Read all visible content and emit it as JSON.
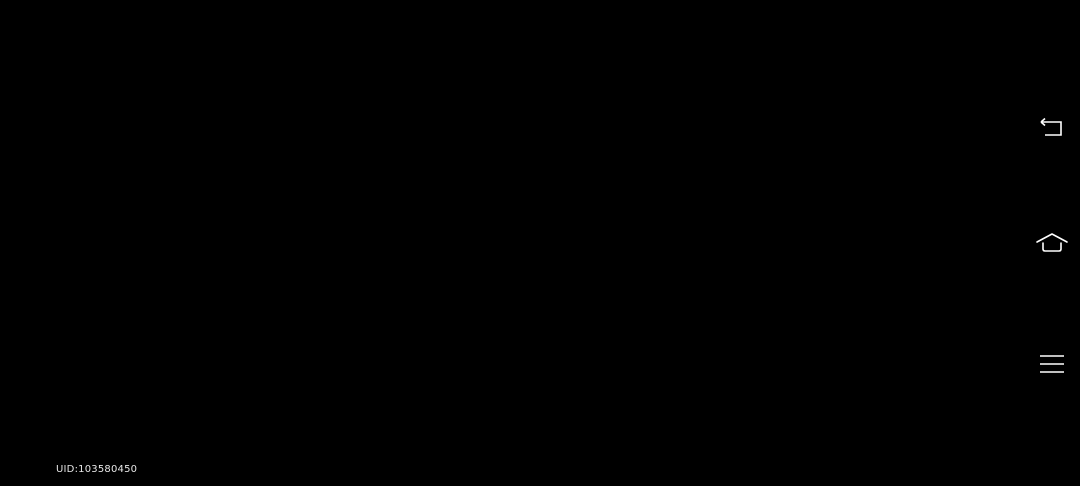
{
  "user": {
    "uid_label": "UID:103580450"
  },
  "nav_bar": {
    "buttons": [
      {
        "name": "back",
        "icon": "back-icon"
      },
      {
        "name": "home",
        "icon": "home-icon"
      },
      {
        "name": "menu",
        "icon": "menu-icon"
      }
    ]
  },
  "colors": {
    "background": "#000000",
    "icon": "#ffffff",
    "text": "#e6e6e6"
  }
}
